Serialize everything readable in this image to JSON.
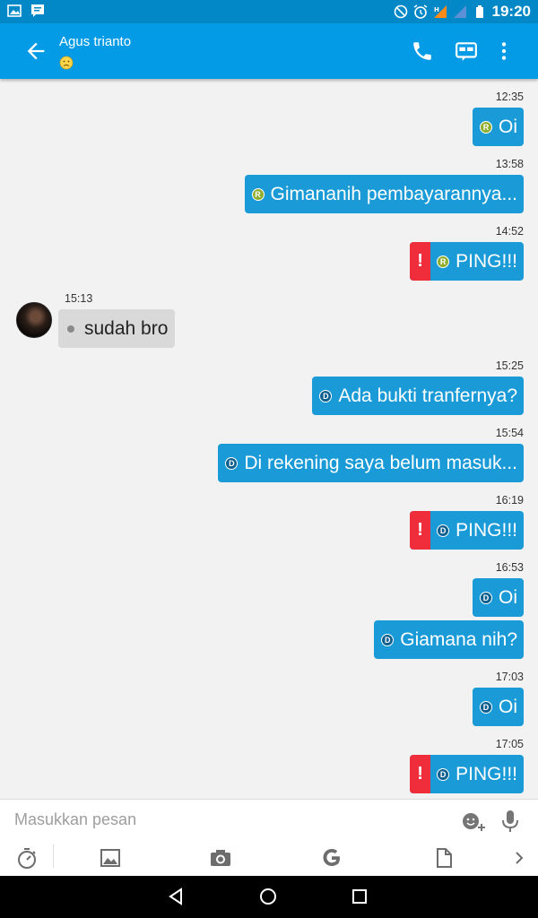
{
  "statusbar": {
    "time": "19:20",
    "left_icons": [
      "image-notification-icon",
      "chat-notification-icon"
    ],
    "right_icons": [
      "do-not-disturb-icon",
      "alarm-icon",
      "signal-icon-1",
      "signal-icon-2",
      "battery-icon"
    ]
  },
  "header": {
    "contact_name": "Agus trianto",
    "status_icon": "sad-emoji-icon",
    "accent": "#039be5"
  },
  "messages": [
    {
      "time": "12:35",
      "text": "Oi",
      "dir": "out",
      "badge": "R",
      "ping": false
    },
    {
      "time": "13:58",
      "text": "Gimananih pembayarannya...",
      "dir": "out",
      "badge": "R",
      "ping": false
    },
    {
      "time": "14:52",
      "text": "PING!!!",
      "dir": "out",
      "badge": "R",
      "ping": true
    },
    {
      "time": "15:13",
      "text": "sudah bro",
      "dir": "in"
    },
    {
      "time": "15:25",
      "text": "Ada bukti tranfernya?",
      "dir": "out",
      "badge": "D",
      "ping": false
    },
    {
      "time": "15:54",
      "text": "Di rekening saya belum masuk...",
      "dir": "out",
      "badge": "D",
      "ping": false
    },
    {
      "time": "16:19",
      "text": "PING!!!",
      "dir": "out",
      "badge": "D",
      "ping": true
    },
    {
      "time": "16:53",
      "text": "Oi",
      "dir": "out",
      "badge": "D",
      "ping": false
    },
    {
      "time": "",
      "text": "Giamana nih?",
      "dir": "out",
      "badge": "D",
      "ping": false
    },
    {
      "time": "17:03",
      "text": "Oi",
      "dir": "out",
      "badge": "D",
      "ping": false
    },
    {
      "time": "17:05",
      "text": "PING!!!",
      "dir": "out",
      "badge": "D",
      "ping": true
    }
  ],
  "badges": {
    "r": "R",
    "d": "D",
    "alert": "!"
  },
  "composer": {
    "placeholder": "Masukkan pesan",
    "tools": [
      "timer-icon",
      "image-icon",
      "camera-icon",
      "google-icon",
      "file-icon",
      "chevron-right-icon"
    ]
  },
  "colors": {
    "outgoing_bubble": "#1a9bd7",
    "incoming_bubble": "#d9d9d9",
    "ping_alert": "#f02d3a",
    "badge_r": "#8fae2e",
    "badge_d": "#0d5f8f"
  }
}
